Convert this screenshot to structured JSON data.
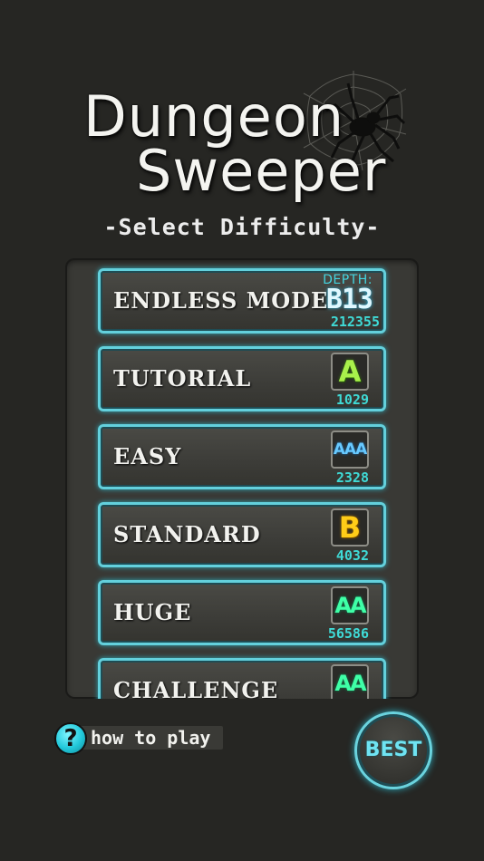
{
  "title": {
    "line1": "Dungeon",
    "line2": "Sweeper",
    "subtitle": "-Select Difficulty-"
  },
  "modes": [
    {
      "label": "ENDLESS MODE",
      "depth_label": "DEPTH:",
      "depth_value": "B13",
      "score": "212355"
    },
    {
      "label": "TUTORIAL",
      "rank": "A",
      "rank_color": "#a9f14b",
      "score": "1029"
    },
    {
      "label": "EASY",
      "rank": "AAA",
      "rank_color": "#67c9ff",
      "score": "2328"
    },
    {
      "label": "STANDARD",
      "rank": "B",
      "rank_color": "#ffcc18",
      "score": "4032"
    },
    {
      "label": "HUGE",
      "rank": "AA",
      "rank_color": "#3fffa7",
      "score": "56586"
    },
    {
      "label": "CHALLENGE",
      "rank": "AA",
      "rank_color": "#3fffa7",
      "score": ""
    }
  ],
  "footer": {
    "howto_icon": "?",
    "howto_label": "how to play",
    "best_label": "BEST"
  },
  "colors": {
    "background": "#262623",
    "accent_cyan": "#63d0dc",
    "panel": "#393935"
  },
  "icons": {
    "spider": "spider-web-icon",
    "help": "question-mark-icon"
  }
}
